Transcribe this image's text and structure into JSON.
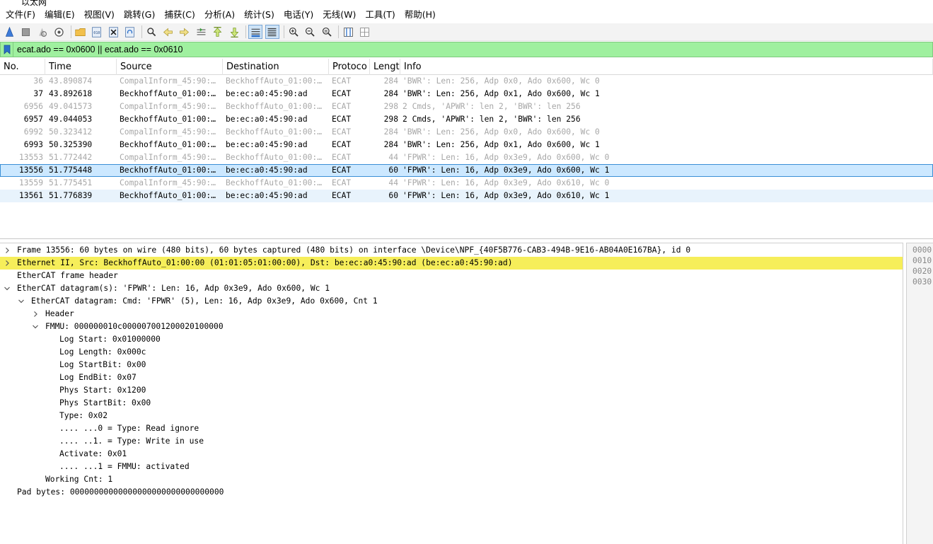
{
  "window": {
    "title": "以太网"
  },
  "menu": [
    "文件(F)",
    "编辑(E)",
    "视图(V)",
    "跳转(G)",
    "捕获(C)",
    "分析(A)",
    "统计(S)",
    "电话(Y)",
    "无线(W)",
    "工具(T)",
    "帮助(H)"
  ],
  "toolbar_icons": [
    "start-capture-icon",
    "stop-capture-icon",
    "restart-capture-icon",
    "capture-options-icon",
    "open-file-icon",
    "save-file-icon",
    "close-file-icon",
    "reload-file-icon",
    "find-packet-icon",
    "go-back-icon",
    "go-forward-icon",
    "go-to-packet-icon",
    "go-first-packet-icon",
    "go-last-packet-icon",
    "autoscroll-icon",
    "colorize-icon",
    "zoom-in-icon",
    "zoom-out-icon",
    "zoom-normal-icon",
    "resize-columns-icon",
    "layout-icon"
  ],
  "filter": {
    "value": "ecat.ado == 0x0600 || ecat.ado == 0x0610"
  },
  "columns": [
    "No.",
    "Time",
    "Source",
    "Destination",
    "Protoco",
    "Lengt",
    "Info"
  ],
  "packets": [
    {
      "no": "36",
      "time": "43.890874",
      "source": "CompalInform_45:90:…",
      "destination": "BeckhoffAuto_01:00:…",
      "protocol": "ECAT",
      "length": "284",
      "info": "'BWR': Len: 256, Adp 0x0, Ado 0x600, Wc 0",
      "state": "dim"
    },
    {
      "no": "37",
      "time": "43.892618",
      "source": "BeckhoffAuto_01:00:…",
      "destination": "be:ec:a0:45:90:ad",
      "protocol": "ECAT",
      "length": "284",
      "info": "'BWR': Len: 256, Adp 0x1, Ado 0x600, Wc 1",
      "state": "normal"
    },
    {
      "no": "6956",
      "time": "49.041573",
      "source": "CompalInform_45:90:…",
      "destination": "BeckhoffAuto_01:00:…",
      "protocol": "ECAT",
      "length": "298",
      "info": "2 Cmds, 'APWR': len 2, 'BWR': len 256",
      "state": "dim"
    },
    {
      "no": "6957",
      "time": "49.044053",
      "source": "BeckhoffAuto_01:00:…",
      "destination": "be:ec:a0:45:90:ad",
      "protocol": "ECAT",
      "length": "298",
      "info": "2 Cmds, 'APWR': len 2, 'BWR': len 256",
      "state": "normal"
    },
    {
      "no": "6992",
      "time": "50.323412",
      "source": "CompalInform_45:90:…",
      "destination": "BeckhoffAuto_01:00:…",
      "protocol": "ECAT",
      "length": "284",
      "info": "'BWR': Len: 256, Adp 0x0, Ado 0x600, Wc 0",
      "state": "dim"
    },
    {
      "no": "6993",
      "time": "50.325390",
      "source": "BeckhoffAuto_01:00:…",
      "destination": "be:ec:a0:45:90:ad",
      "protocol": "ECAT",
      "length": "284",
      "info": "'BWR': Len: 256, Adp 0x1, Ado 0x600, Wc 1",
      "state": "normal"
    },
    {
      "no": "13553",
      "time": "51.772442",
      "source": "CompalInform_45:90:…",
      "destination": "BeckhoffAuto_01:00:…",
      "protocol": "ECAT",
      "length": "44",
      "info": "'FPWR': Len: 16, Adp 0x3e9, Ado 0x600, Wc 0",
      "state": "dim"
    },
    {
      "no": "13556",
      "time": "51.775448",
      "source": "BeckhoffAuto_01:00:…",
      "destination": "be:ec:a0:45:90:ad",
      "protocol": "ECAT",
      "length": "60",
      "info": "'FPWR': Len: 16, Adp 0x3e9, Ado 0x600, Wc 1",
      "state": "selected"
    },
    {
      "no": "13559",
      "time": "51.775451",
      "source": "CompalInform_45:90:…",
      "destination": "BeckhoffAuto_01:00:…",
      "protocol": "ECAT",
      "length": "44",
      "info": "'FPWR': Len: 16, Adp 0x3e9, Ado 0x610, Wc 0",
      "state": "dim"
    },
    {
      "no": "13561",
      "time": "51.776839",
      "source": "BeckhoffAuto_01:00:…",
      "destination": "be:ec:a0:45:90:ad",
      "protocol": "ECAT",
      "length": "60",
      "info": "'FPWR': Len: 16, Adp 0x3e9, Ado 0x610, Wc 1",
      "state": "related"
    }
  ],
  "details": [
    {
      "level": 0,
      "chevron": "collapsed",
      "text": "Frame 13556: 60 bytes on wire (480 bits), 60 bytes captured (480 bits) on interface \\Device\\NPF_{40F5B776-CAB3-494B-9E16-AB04A0E167BA}, id 0",
      "highlight": false
    },
    {
      "level": 0,
      "chevron": "collapsed",
      "text": "Ethernet II, Src: BeckhoffAuto_01:00:00 (01:01:05:01:00:00), Dst: be:ec:a0:45:90:ad (be:ec:a0:45:90:ad)",
      "highlight": true
    },
    {
      "level": 0,
      "chevron": "none",
      "text": "EtherCAT frame header",
      "highlight": false
    },
    {
      "level": 0,
      "chevron": "expanded",
      "text": "EtherCAT datagram(s): 'FPWR': Len: 16, Adp 0x3e9, Ado 0x600, Wc 1",
      "highlight": false
    },
    {
      "level": 1,
      "chevron": "expanded",
      "text": "EtherCAT datagram: Cmd: 'FPWR' (5), Len: 16, Adp 0x3e9, Ado 0x600, Cnt 1",
      "highlight": false
    },
    {
      "level": 2,
      "chevron": "collapsed",
      "text": "Header",
      "highlight": false
    },
    {
      "level": 2,
      "chevron": "expanded",
      "text": "FMMU: 000000010c000007001200020100000",
      "highlight": false
    },
    {
      "level": 3,
      "chevron": "none",
      "text": "Log Start: 0x01000000",
      "highlight": false
    },
    {
      "level": 3,
      "chevron": "none",
      "text": "Log Length: 0x000c",
      "highlight": false
    },
    {
      "level": 3,
      "chevron": "none",
      "text": "Log StartBit: 0x00",
      "highlight": false
    },
    {
      "level": 3,
      "chevron": "none",
      "text": "Log EndBit: 0x07",
      "highlight": false
    },
    {
      "level": 3,
      "chevron": "none",
      "text": "Phys Start: 0x1200",
      "highlight": false
    },
    {
      "level": 3,
      "chevron": "none",
      "text": "Phys StartBit: 0x00",
      "highlight": false
    },
    {
      "level": 3,
      "chevron": "none",
      "text": "Type: 0x02",
      "highlight": false
    },
    {
      "level": 3,
      "chevron": "none",
      "text": ".... ...0 = Type: Read ignore",
      "highlight": false
    },
    {
      "level": 3,
      "chevron": "none",
      "text": ".... ..1. = Type: Write in use",
      "highlight": false
    },
    {
      "level": 3,
      "chevron": "none",
      "text": "Activate: 0x01",
      "highlight": false
    },
    {
      "level": 3,
      "chevron": "none",
      "text": ".... ...1 = FMMU: activated",
      "highlight": false
    },
    {
      "level": 2,
      "chevron": "none",
      "text": "Working Cnt: 1",
      "highlight": false
    },
    {
      "level": 0,
      "chevron": "none",
      "text": "Pad bytes: 00000000000000000000000000000000",
      "highlight": false
    }
  ],
  "bytes_offsets": [
    "0000",
    "0010",
    "0020",
    "0030"
  ],
  "colors": {
    "filter_valid": "#9ff09f",
    "selected_row": "#cce8ff",
    "related_row": "#e8f3fc",
    "highlight_field": "#f6ee5a",
    "dim_text": "#a8a8a8"
  }
}
